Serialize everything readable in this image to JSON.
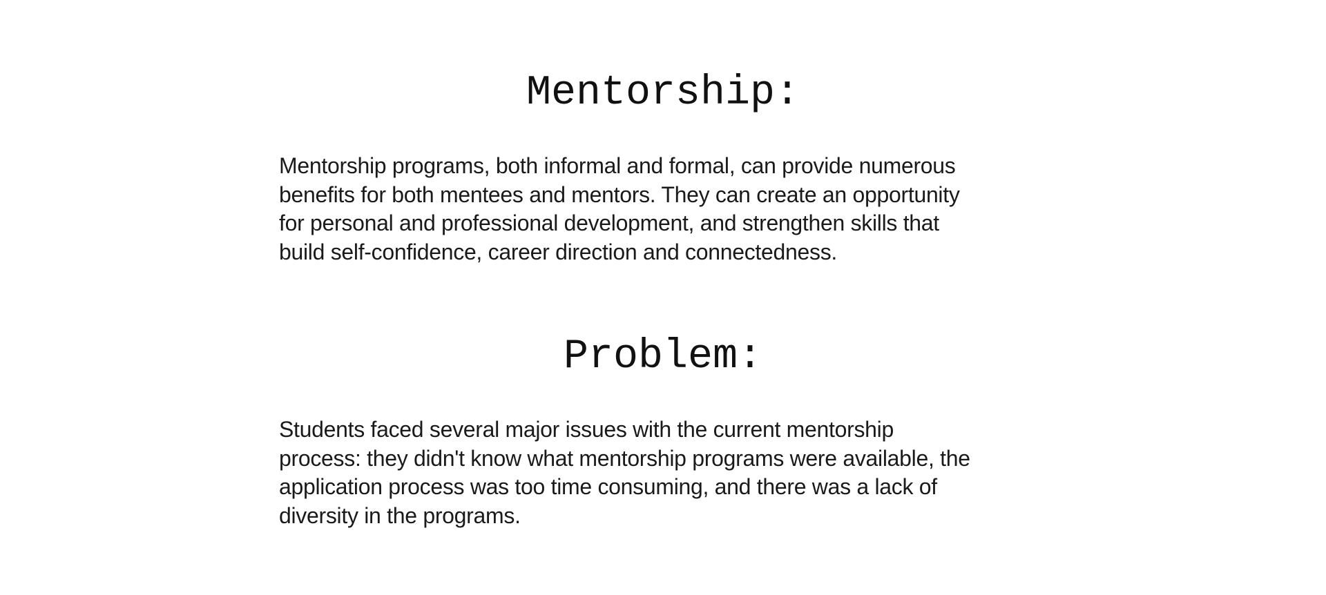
{
  "sections": [
    {
      "heading": "Mentorship:",
      "lines": [
        "Mentorship programs, both informal and formal, can provide numerous",
        "benefits for both mentees and mentors. They can create an opportunity",
        "for personal and professional development, and strengthen skills that",
        "build self-confidence, career direction and connectedness."
      ]
    },
    {
      "heading": "Problem:",
      "lines": [
        "Students faced several major issues with the current mentorship",
        "process: they didn't know what mentorship programs were available, the",
        "application process was too time consuming, and there was a lack of",
        "diversity in the programs."
      ]
    }
  ]
}
